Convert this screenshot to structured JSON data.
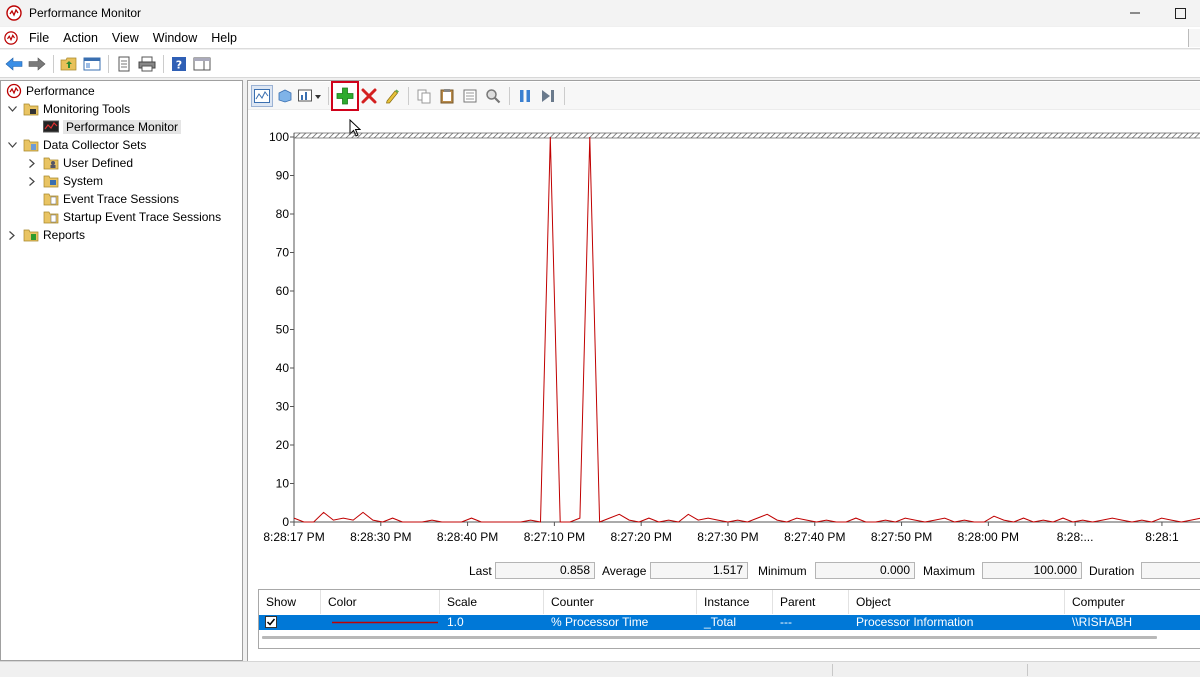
{
  "window": {
    "title": "Performance Monitor"
  },
  "menu": [
    "File",
    "Action",
    "View",
    "Window",
    "Help"
  ],
  "tree": {
    "root": "Performance",
    "monitoring_tools": "Monitoring Tools",
    "performance_monitor": "Performance Monitor",
    "data_collector_sets": "Data Collector Sets",
    "user_defined": "User Defined",
    "system": "System",
    "event_trace_sessions": "Event Trace Sessions",
    "startup_event_trace_sessions": "Startup Event Trace Sessions",
    "reports": "Reports"
  },
  "stats": {
    "last_label": "Last",
    "last_value": "0.858",
    "average_label": "Average",
    "average_value": "1.517",
    "minimum_label": "Minimum",
    "minimum_value": "0.000",
    "maximum_label": "Maximum",
    "maximum_value": "100.000",
    "duration_label": "Duration"
  },
  "legend": {
    "headers": [
      "Show",
      "Color",
      "Scale",
      "Counter",
      "Instance",
      "Parent",
      "Object",
      "Computer"
    ],
    "row": {
      "scale": "1.0",
      "counter": "% Processor Time",
      "instance": "_Total",
      "parent": "---",
      "object": "Processor Information",
      "computer": "\\\\RISHABH"
    }
  },
  "colors": {
    "series": "#c00000",
    "selection": "#0078d7",
    "highlight": "#d0021b"
  },
  "chart_data": {
    "type": "line",
    "ylim": [
      0,
      100
    ],
    "yticks": [
      0,
      10,
      20,
      30,
      40,
      50,
      60,
      70,
      80,
      90,
      100
    ],
    "xtick_labels": [
      "8:28:17 PM",
      "8:28:30 PM",
      "8:28:40 PM",
      "8:27:10 PM",
      "8:27:20 PM",
      "8:27:30 PM",
      "8:27:40 PM",
      "8:27:50 PM",
      "8:28:00 PM",
      "8:28:...",
      "8:28:1"
    ],
    "grid": false,
    "series": [
      {
        "values": [
          1,
          0,
          0,
          2.5,
          0.5,
          1,
          0.5,
          2.5,
          0.5,
          0,
          1,
          0,
          0,
          0,
          0.5,
          0,
          0,
          0,
          1,
          0,
          0,
          0,
          0,
          0,
          0.5,
          0,
          100,
          0,
          0,
          1,
          100,
          0,
          1,
          2,
          0.5,
          0,
          1,
          0,
          0.5,
          0,
          2,
          0.5,
          1,
          0.5,
          0,
          0.5,
          0,
          1,
          2,
          0.5,
          0,
          1,
          0.5,
          0,
          0.5,
          0,
          0,
          1,
          0,
          0,
          0.5,
          0,
          1,
          0.5,
          0,
          0.5,
          1,
          0,
          0.5,
          0,
          0,
          1.5,
          0.5,
          0,
          1,
          0,
          0.5,
          0,
          1,
          0,
          0.5,
          0,
          0.5,
          1,
          0.5,
          0,
          0.5,
          0,
          1,
          0.5,
          0,
          0.5,
          1
        ]
      }
    ]
  }
}
